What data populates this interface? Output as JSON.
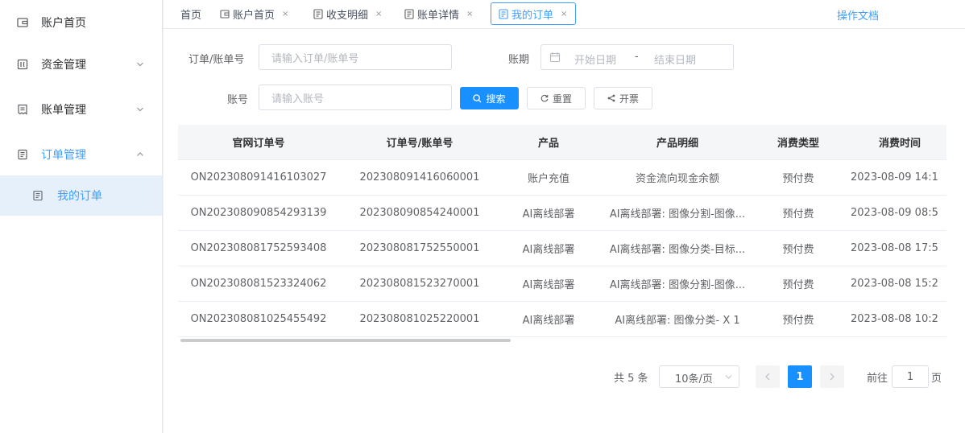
{
  "sidebar": {
    "items": [
      {
        "label": "账户首页",
        "icon": "wallet-icon"
      },
      {
        "label": "资金管理",
        "icon": "fund-icon"
      },
      {
        "label": "账单管理",
        "icon": "bill-icon"
      },
      {
        "label": "订单管理",
        "icon": "order-icon"
      }
    ],
    "sub_item": {
      "label": "我的订单",
      "icon": "document-icon"
    }
  },
  "tabs": [
    {
      "label": "首页"
    },
    {
      "label": "账户首页",
      "close": "×"
    },
    {
      "label": "收支明细",
      "close": "×"
    },
    {
      "label": "账单详情",
      "close": "×"
    },
    {
      "label": "我的订单",
      "close": "×"
    }
  ],
  "header": {
    "doc_link": "操作文档"
  },
  "filters": {
    "order_label": "订单/账单号",
    "order_placeholder": "请输入订单/账单号",
    "period_label": "账期",
    "start_placeholder": "开始日期",
    "range_sep": "-",
    "end_placeholder": "结束日期",
    "account_label": "账号",
    "account_placeholder": "请输入账号",
    "search_btn": "搜索",
    "reset_btn": "重置",
    "invoice_btn": "开票"
  },
  "table": {
    "columns": [
      "官网订单号",
      "订单号/账单号",
      "产品",
      "产品明细",
      "消费类型",
      "消费时间"
    ],
    "rows": [
      [
        "ON202308091416103027",
        "202308091416060001",
        "账户充值",
        "资金流向现金余额",
        "预付费",
        "2023-08-09 14:1"
      ],
      [
        "ON202308090854293139",
        "202308090854240001",
        "AI离线部署",
        "AI离线部署: 图像分割-图像...",
        "预付费",
        "2023-08-09 08:5"
      ],
      [
        "ON202308081752593408",
        "202308081752550001",
        "AI离线部署",
        "AI离线部署: 图像分类-目标...",
        "预付费",
        "2023-08-08 17:5"
      ],
      [
        "ON202308081523324062",
        "202308081523270001",
        "AI离线部署",
        "AI离线部署: 图像分割-图像...",
        "预付费",
        "2023-08-08 15:2"
      ],
      [
        "ON202308081025455492",
        "202308081025220001",
        "AI离线部署",
        "AI离线部署: 图像分类- X 1",
        "预付费",
        "2023-08-08 10:2"
      ]
    ]
  },
  "pagination": {
    "total": "共 5 条",
    "page_size": "10条/页",
    "current": "1",
    "goto_label": "前往",
    "goto_value": "1",
    "page_suffix": "页"
  },
  "colors": {
    "accent": "#409eff",
    "primary_btn": "#1890ff"
  }
}
